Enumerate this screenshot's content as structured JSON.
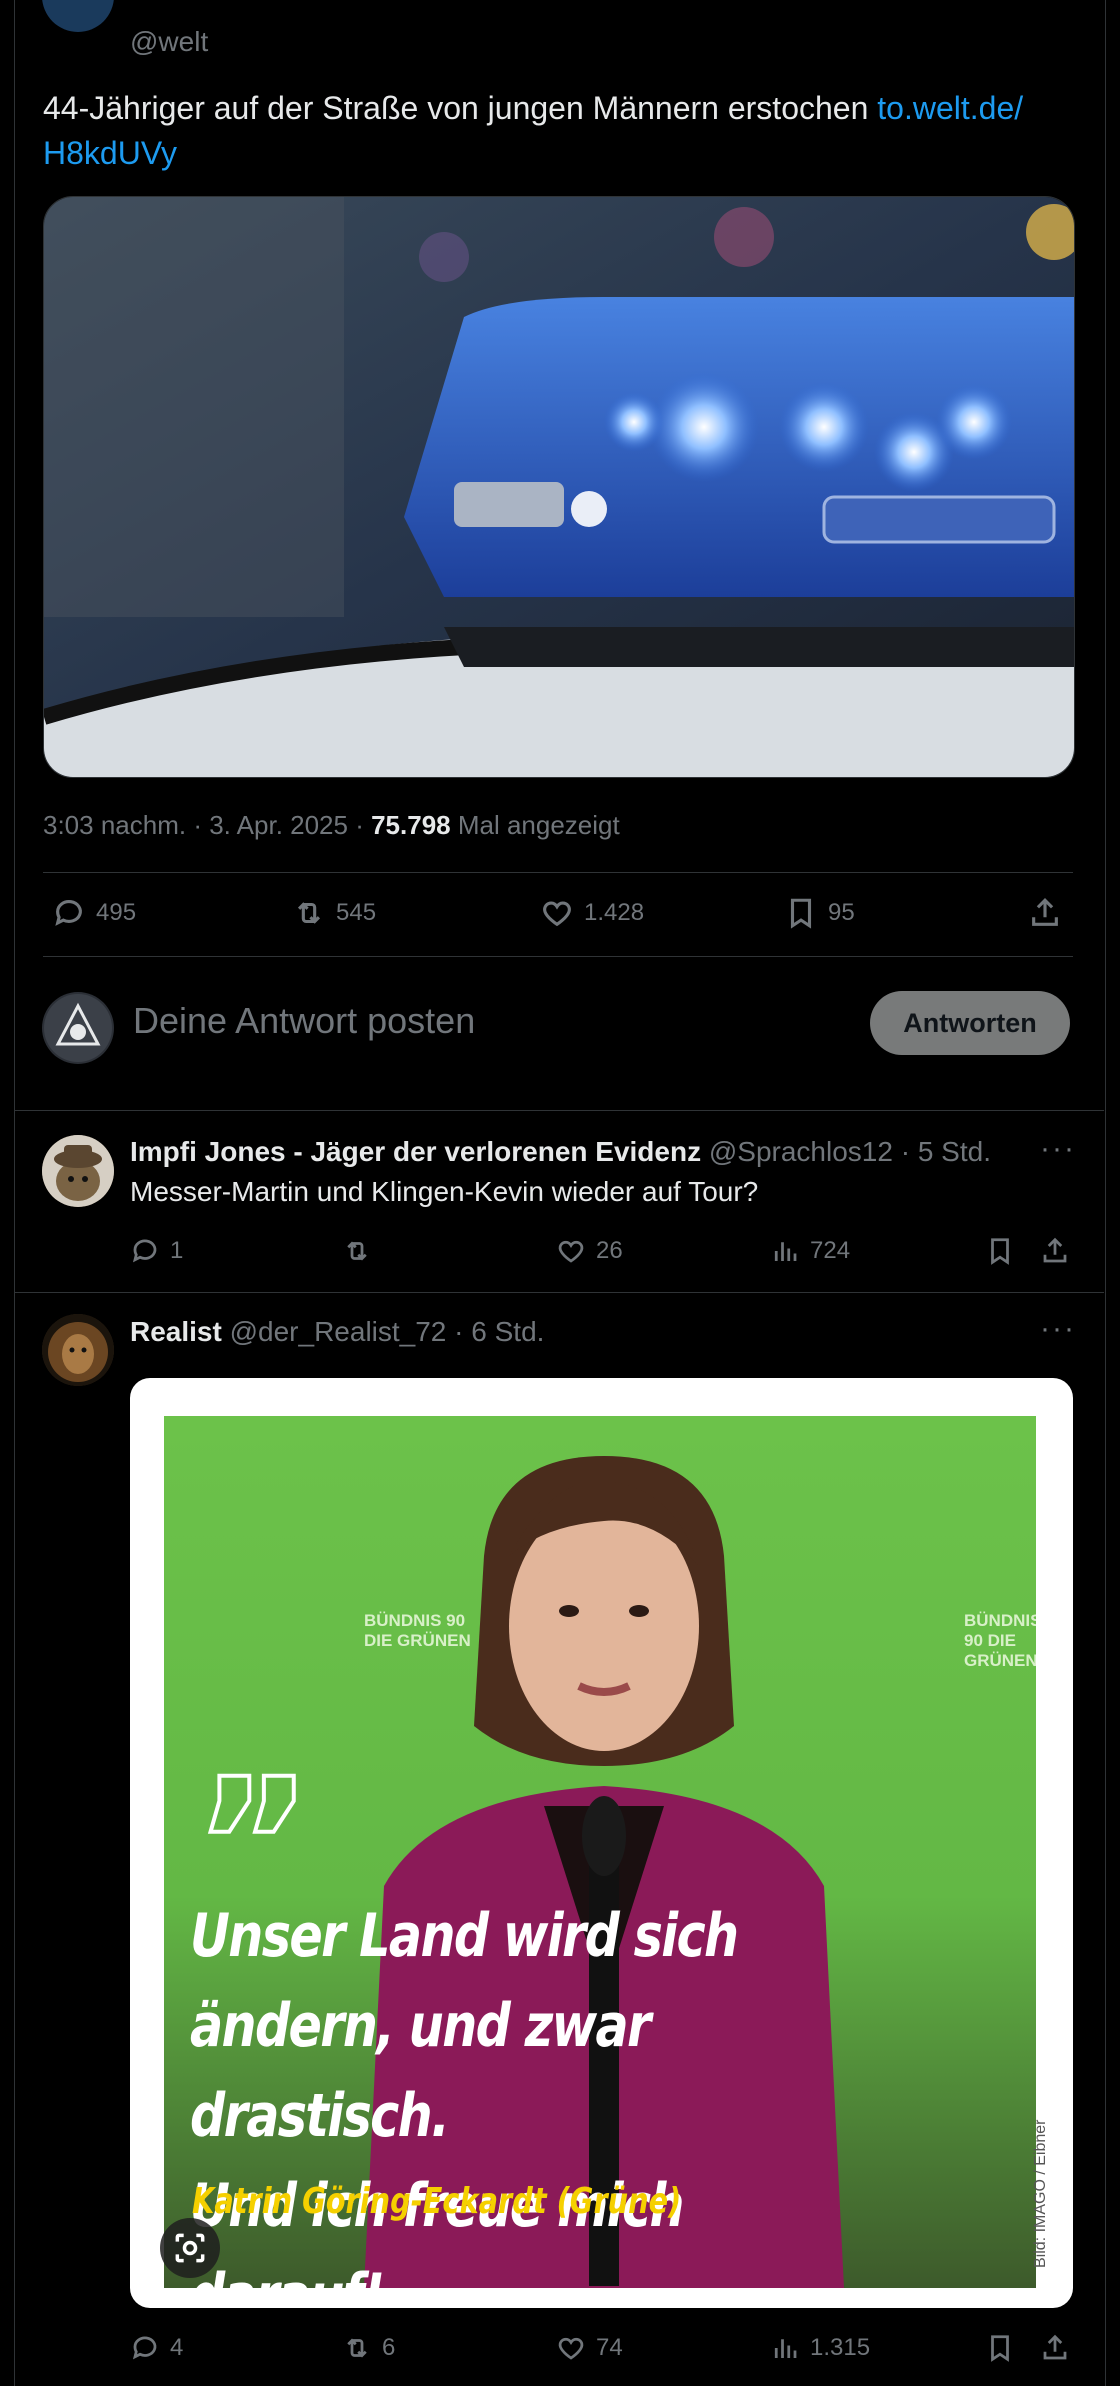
{
  "main_tweet": {
    "handle": "@welt",
    "text": "44-Jähriger auf der Straße von jungen Männern erstochen ",
    "link_line1": "to.welt.de/",
    "link_line2": "H8kdUVy",
    "time": "3:03 nachm. · 3. Apr. 2025 · ",
    "views_count": "75.798",
    "views_label": " Mal angezeigt",
    "actions": {
      "replies": "495",
      "reposts": "545",
      "likes": "1.428",
      "bookmarks": "95"
    }
  },
  "compose": {
    "placeholder": "Deine Antwort posten",
    "button_label": "Antworten"
  },
  "replies": [
    {
      "name": "Impfi Jones - Jäger der verlorenen Evidenz",
      "handle": " @Sprachlos12 · 5 Std.",
      "text": "Messer-Martin und Klingen-Kevin wieder auf Tour?",
      "actions": {
        "replies": "1",
        "reposts": "",
        "likes": "26",
        "views": "724"
      }
    },
    {
      "name": "Realist",
      "handle": " @der_Realist_72 · 6 Std.",
      "image": {
        "quote": "Unser Land wird sich ändern, und zwar drastisch. Und ich freue mich darauf!",
        "quote_line1": "Unser Land wird sich",
        "quote_line2": "ändern, und zwar drastisch.",
        "quote_line3": "Und ich freue mich darauf!",
        "attribution": "Katrin Göring-Eckardt (Grüne)",
        "credit": "Bild: IMAGO / Eibner",
        "banner": "BÜNDNIS 90 DIE GRÜNEN"
      },
      "actions": {
        "replies": "4",
        "reposts": "6",
        "likes": "74",
        "views": "1.315"
      }
    }
  ],
  "colors": {
    "background": "#000000",
    "accent": "#1d9bf0",
    "muted": "#71767b",
    "border": "#2f3336",
    "green_bg": "#6cc24a",
    "quote_yellow": "#f5d000"
  }
}
